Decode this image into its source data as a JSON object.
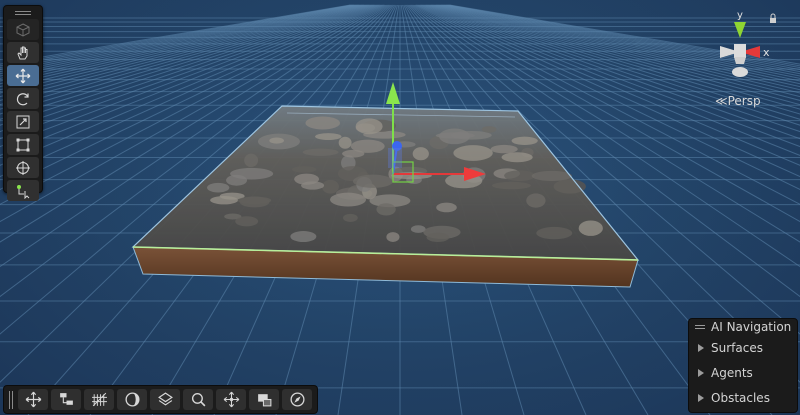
{
  "viewport": {
    "background": "#234468",
    "grid_color": "#5d87ad",
    "projection_label": "Persp"
  },
  "tools": [
    {
      "name": "view-tool",
      "icon": "cube-icon",
      "active": false,
      "faded": true
    },
    {
      "name": "hand-tool",
      "icon": "hand-icon",
      "active": false
    },
    {
      "name": "move-tool",
      "icon": "move-arrows-icon",
      "active": true
    },
    {
      "name": "rotate-tool",
      "icon": "rotate-icon",
      "active": false
    },
    {
      "name": "scale-tool",
      "icon": "scale-icon",
      "active": false
    },
    {
      "name": "rect-tool",
      "icon": "rect-transform-icon",
      "active": false
    },
    {
      "name": "transform-tool",
      "icon": "transform-icon",
      "active": false
    },
    {
      "name": "custom-tool",
      "icon": "custom-tool-icon",
      "active": false
    }
  ],
  "gizmo": {
    "axis_y": "y",
    "axis_x": "x",
    "colors": {
      "x": "#e4393a",
      "y": "#8fd532",
      "z": "#3c66f0"
    }
  },
  "ai_navigation": {
    "title": "AI Navigation",
    "items": [
      {
        "label": "Surfaces"
      },
      {
        "label": "Agents"
      },
      {
        "label": "Obstacles"
      }
    ]
  },
  "bottom_toolbar": [
    {
      "name": "move-toggle",
      "icon": "move-icon"
    },
    {
      "name": "pivot-toggle",
      "icon": "pivot-icon"
    },
    {
      "name": "grid-toggle",
      "icon": "grid-icon"
    },
    {
      "name": "shading-toggle",
      "icon": "shading-icon"
    },
    {
      "name": "layers-toggle",
      "icon": "layers-icon"
    },
    {
      "name": "search-toggle",
      "icon": "search-icon"
    },
    {
      "name": "snap-toggle",
      "icon": "snap-icon"
    },
    {
      "name": "camera-toggle",
      "icon": "camera-icon"
    },
    {
      "name": "navigate-toggle",
      "icon": "compass-icon"
    }
  ]
}
